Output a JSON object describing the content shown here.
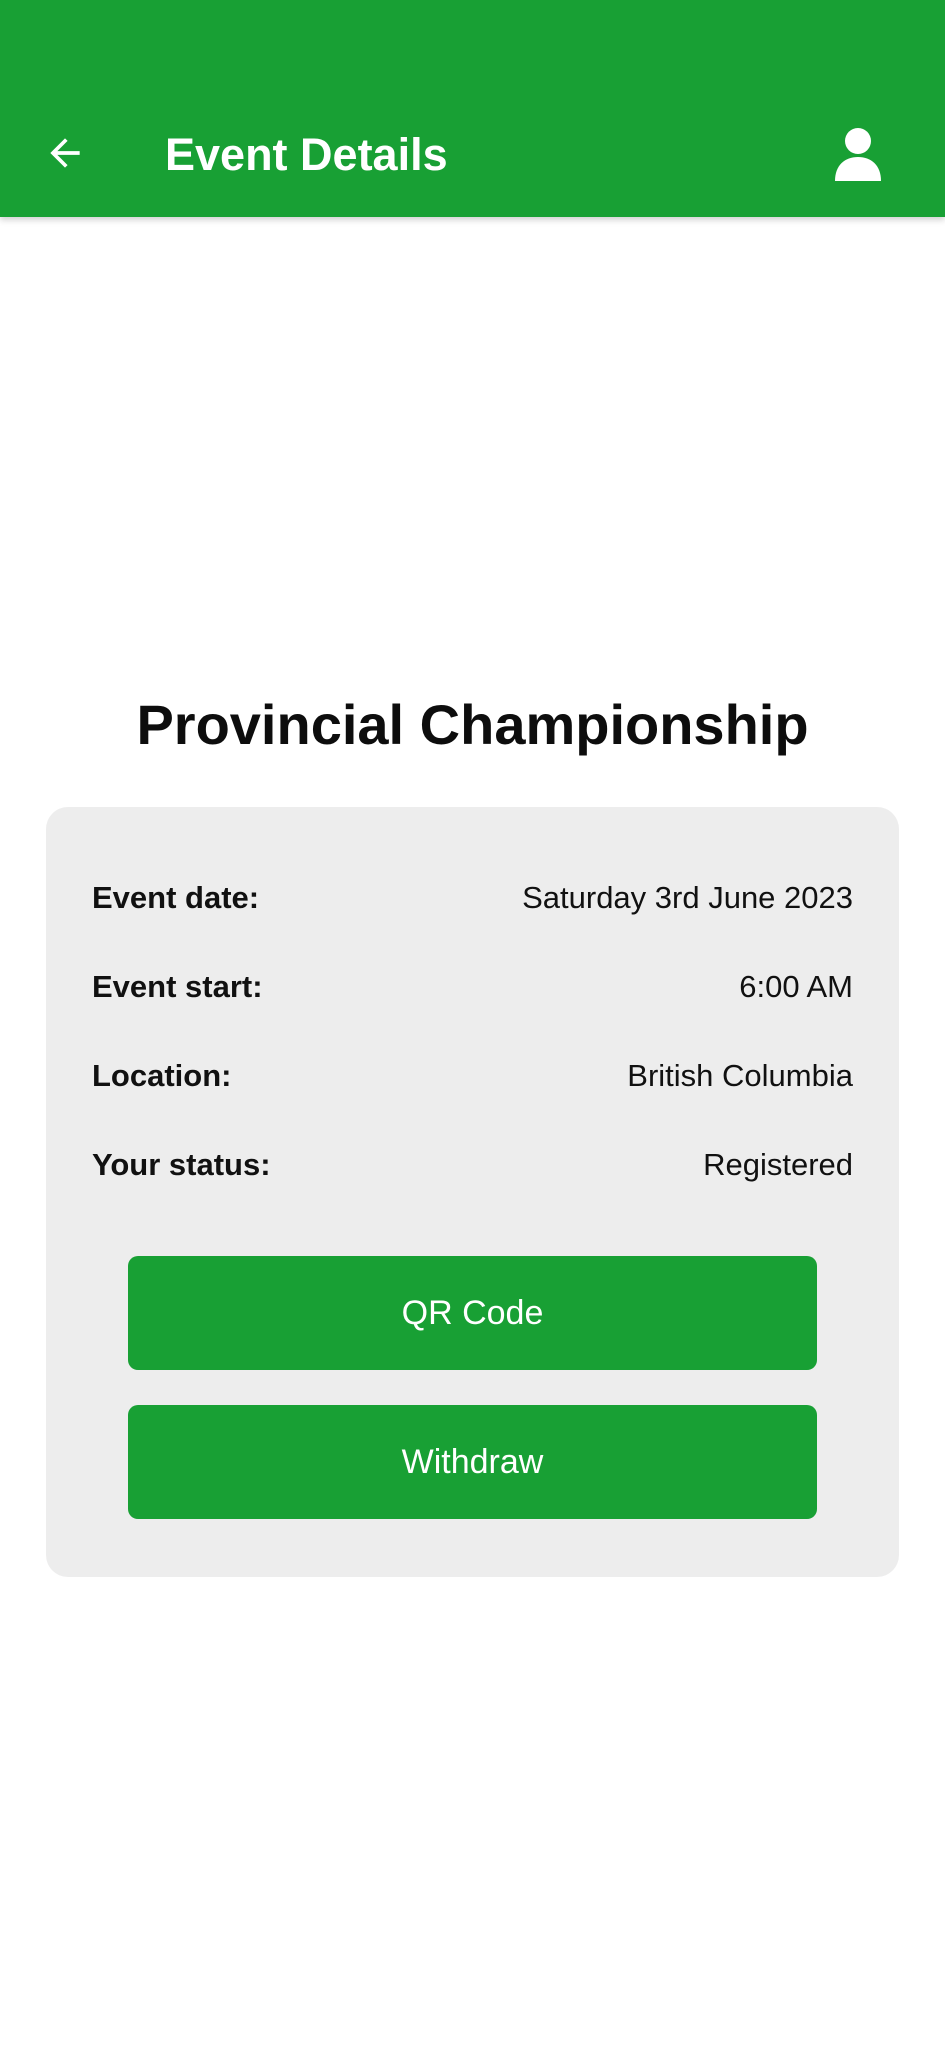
{
  "app_bar": {
    "title": "Event Details",
    "back_icon": "arrow-left-icon",
    "profile_icon": "person-icon",
    "background_color": "#18A034"
  },
  "event": {
    "name": "Provincial Championship",
    "details": [
      {
        "label": "Event date:",
        "value": "Saturday 3rd June 2023"
      },
      {
        "label": "Event start:",
        "value": "6:00 AM"
      },
      {
        "label": "Location:",
        "value": "British Columbia"
      },
      {
        "label": "Your status:",
        "value": "Registered"
      }
    ]
  },
  "actions": {
    "qr_code_label": "QR Code",
    "withdraw_label": "Withdraw",
    "button_color": "#18A034"
  }
}
